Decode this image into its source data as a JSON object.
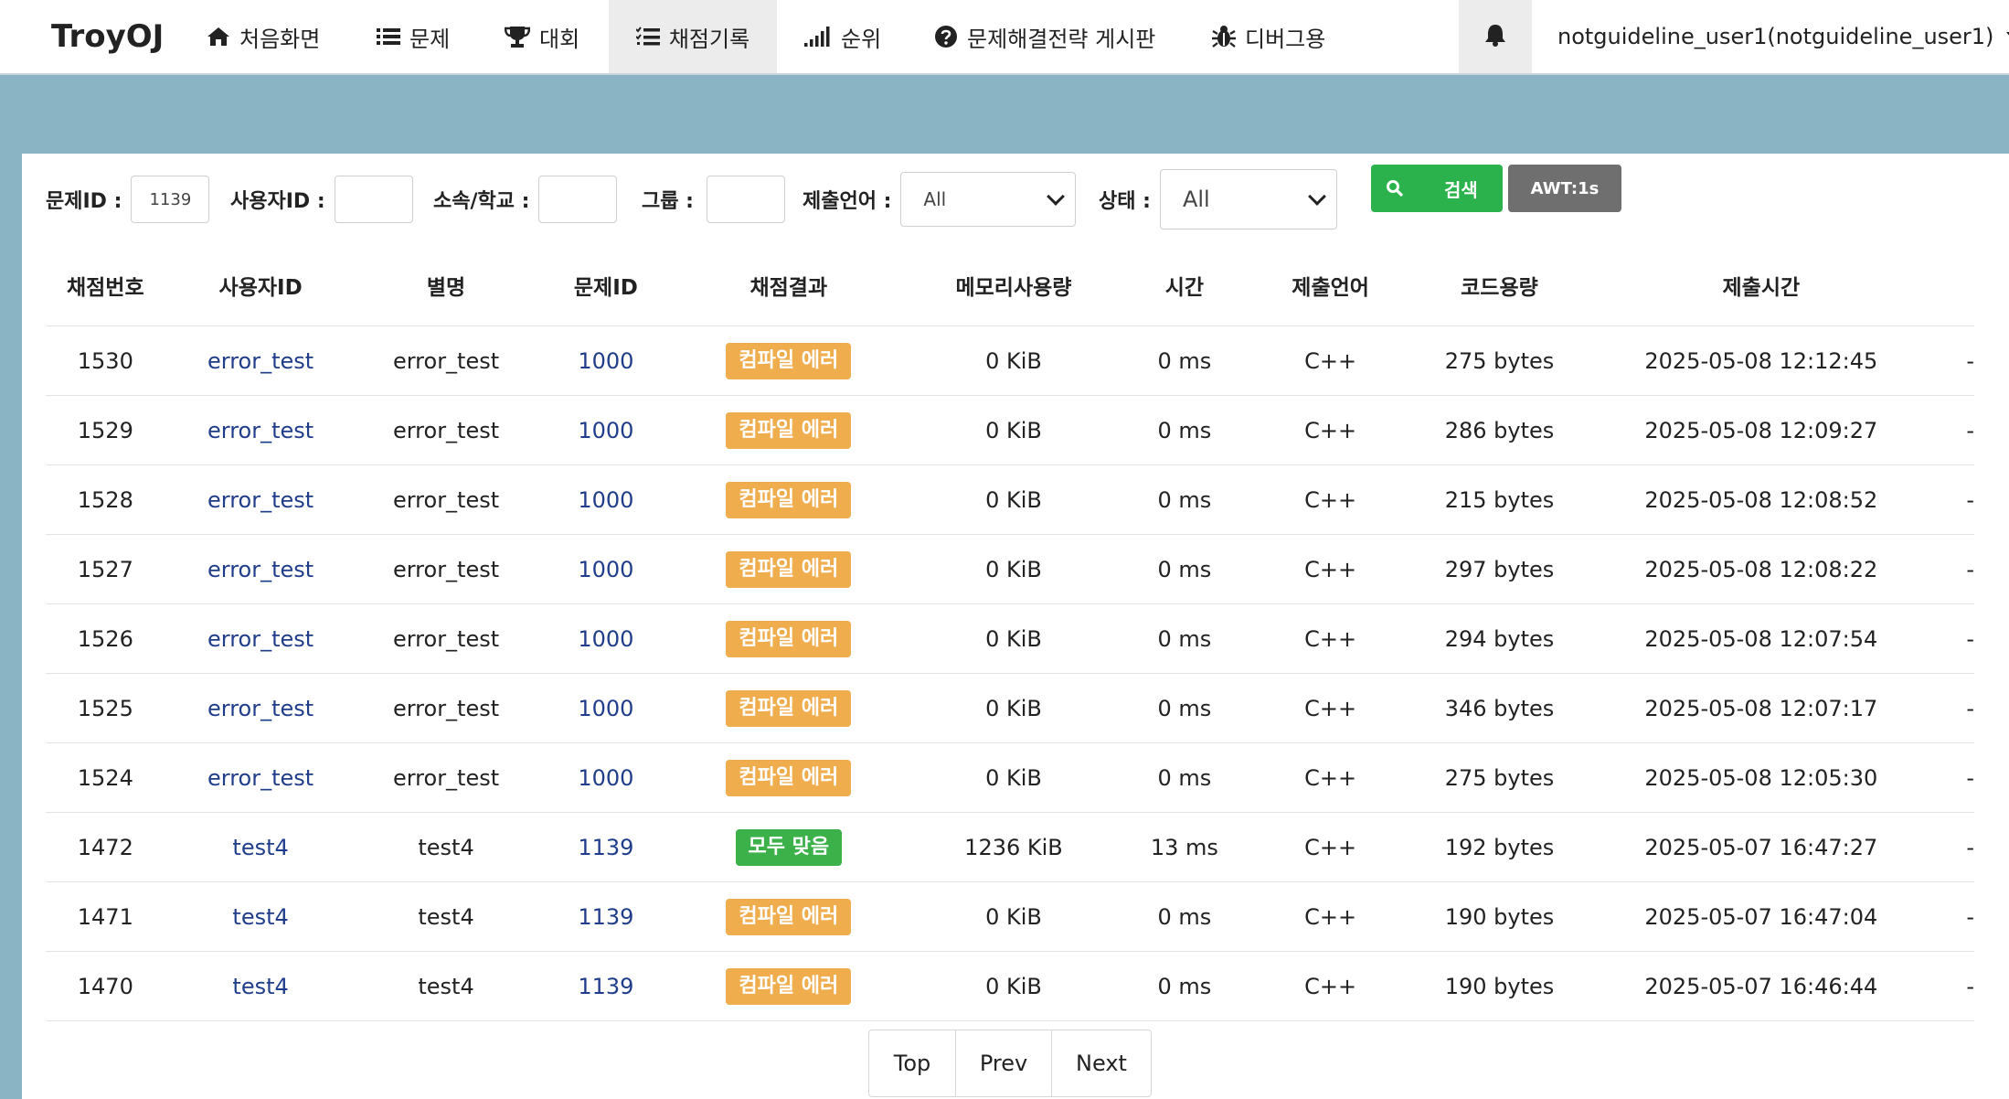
{
  "nav": {
    "brand": "TroyOJ",
    "items": [
      {
        "label": "처음화면",
        "icon": "home-icon"
      },
      {
        "label": "문제",
        "icon": "list-icon"
      },
      {
        "label": "대회",
        "icon": "trophy-icon"
      },
      {
        "label": "채점기록",
        "icon": "tasks-icon"
      },
      {
        "label": "순위",
        "icon": "signal-icon"
      },
      {
        "label": "문제해결전략 게시판",
        "icon": "question-circle-icon"
      },
      {
        "label": "디버그용",
        "icon": "bug-icon"
      }
    ],
    "user": "notguideline_user1(notguideline_user1)"
  },
  "filters": {
    "problem_id_label": "문제ID :",
    "problem_id_value": "1139",
    "user_id_label": "사용자ID :",
    "school_label": "소속/학교 :",
    "group_label": "그룹 :",
    "language_label": "제출언어 :",
    "language_value": "All",
    "status_label": "상태 :",
    "status_value": "All",
    "search_label": "검색",
    "awt_label": "AWT:1s"
  },
  "table": {
    "headers": [
      "채점번호",
      "사용자ID",
      "별명",
      "문제ID",
      "채점결과",
      "메모리사용량",
      "시간",
      "제출언어",
      "코드용량",
      "제출시간"
    ],
    "rows": [
      {
        "id": "1530",
        "user": "error_test",
        "nick": "error_test",
        "problem": "1000",
        "result": "컴파일 에러",
        "result_type": "ce",
        "memory": "0 KiB",
        "time": "0 ms",
        "lang": "C++",
        "size": "275 bytes",
        "submitted": "2025-05-08 12:12:45",
        "extra": "-"
      },
      {
        "id": "1529",
        "user": "error_test",
        "nick": "error_test",
        "problem": "1000",
        "result": "컴파일 에러",
        "result_type": "ce",
        "memory": "0 KiB",
        "time": "0 ms",
        "lang": "C++",
        "size": "286 bytes",
        "submitted": "2025-05-08 12:09:27",
        "extra": "-"
      },
      {
        "id": "1528",
        "user": "error_test",
        "nick": "error_test",
        "problem": "1000",
        "result": "컴파일 에러",
        "result_type": "ce",
        "memory": "0 KiB",
        "time": "0 ms",
        "lang": "C++",
        "size": "215 bytes",
        "submitted": "2025-05-08 12:08:52",
        "extra": "-"
      },
      {
        "id": "1527",
        "user": "error_test",
        "nick": "error_test",
        "problem": "1000",
        "result": "컴파일 에러",
        "result_type": "ce",
        "memory": "0 KiB",
        "time": "0 ms",
        "lang": "C++",
        "size": "297 bytes",
        "submitted": "2025-05-08 12:08:22",
        "extra": "-"
      },
      {
        "id": "1526",
        "user": "error_test",
        "nick": "error_test",
        "problem": "1000",
        "result": "컴파일 에러",
        "result_type": "ce",
        "memory": "0 KiB",
        "time": "0 ms",
        "lang": "C++",
        "size": "294 bytes",
        "submitted": "2025-05-08 12:07:54",
        "extra": "-"
      },
      {
        "id": "1525",
        "user": "error_test",
        "nick": "error_test",
        "problem": "1000",
        "result": "컴파일 에러",
        "result_type": "ce",
        "memory": "0 KiB",
        "time": "0 ms",
        "lang": "C++",
        "size": "346 bytes",
        "submitted": "2025-05-08 12:07:17",
        "extra": "-"
      },
      {
        "id": "1524",
        "user": "error_test",
        "nick": "error_test",
        "problem": "1000",
        "result": "컴파일 에러",
        "result_type": "ce",
        "memory": "0 KiB",
        "time": "0 ms",
        "lang": "C++",
        "size": "275 bytes",
        "submitted": "2025-05-08 12:05:30",
        "extra": "-"
      },
      {
        "id": "1472",
        "user": "test4",
        "nick": "test4",
        "problem": "1139",
        "result": "모두 맞음",
        "result_type": "ac",
        "memory": "1236 KiB",
        "time": "13 ms",
        "lang": "C++",
        "size": "192 bytes",
        "submitted": "2025-05-07 16:47:27",
        "extra": "-"
      },
      {
        "id": "1471",
        "user": "test4",
        "nick": "test4",
        "problem": "1139",
        "result": "컴파일 에러",
        "result_type": "ce",
        "memory": "0 KiB",
        "time": "0 ms",
        "lang": "C++",
        "size": "190 bytes",
        "submitted": "2025-05-07 16:47:04",
        "extra": "-"
      },
      {
        "id": "1470",
        "user": "test4",
        "nick": "test4",
        "problem": "1139",
        "result": "컴파일 에러",
        "result_type": "ce",
        "memory": "0 KiB",
        "time": "0 ms",
        "lang": "C++",
        "size": "190 bytes",
        "submitted": "2025-05-07 16:46:44",
        "extra": "-"
      }
    ]
  },
  "pager": {
    "top": "Top",
    "prev": "Prev",
    "next": "Next"
  },
  "colors": {
    "background": "#8ab3c4",
    "compile_error": "#f0ad4e",
    "accepted": "#3cb14a",
    "search_button": "#2bb24c",
    "awt_button": "#6f6f6f",
    "link": "#1f3d8a"
  }
}
